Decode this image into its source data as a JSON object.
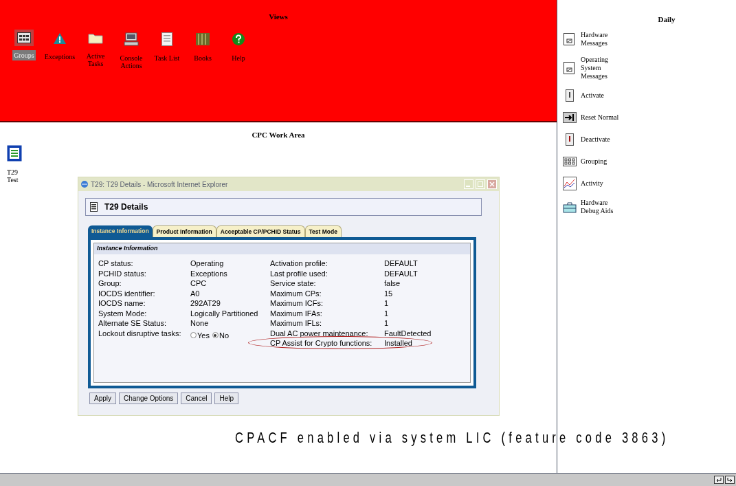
{
  "views": {
    "title": "Views",
    "items": [
      {
        "label": "Groups",
        "kind": "groups",
        "selected": true
      },
      {
        "label": "Exceptions",
        "kind": "warning",
        "selected": false
      },
      {
        "label": "Active Tasks",
        "kind": "folder",
        "selected": false
      },
      {
        "label": "Console Actions",
        "kind": "computer",
        "selected": false
      },
      {
        "label": "Task List",
        "kind": "list",
        "selected": false
      },
      {
        "label": "Books",
        "kind": "books",
        "selected": false
      },
      {
        "label": "Help",
        "kind": "help",
        "selected": false
      }
    ]
  },
  "work_area": {
    "title": "CPC Work Area",
    "objects": [
      {
        "label": "T29 Test"
      }
    ]
  },
  "daily": {
    "title": "Daily",
    "items": [
      {
        "label": "Hardware Messages",
        "kind": "document"
      },
      {
        "label": "Operating System Messages",
        "kind": "document"
      },
      {
        "label": "Activate",
        "kind": "activate"
      },
      {
        "label": "Reset Normal",
        "kind": "reset"
      },
      {
        "label": "Deactivate",
        "kind": "deactivate"
      },
      {
        "label": "Grouping",
        "kind": "groups"
      },
      {
        "label": "Activity",
        "kind": "activity"
      },
      {
        "label": "Hardware Debug Aids",
        "kind": "toolbox"
      }
    ]
  },
  "dialog": {
    "window_title": "T29: T29 Details - Microsoft Internet Explorer",
    "header": "T29 Details",
    "tabs": [
      {
        "label": "Instance Information",
        "selected": true
      },
      {
        "label": "Product Information",
        "selected": false
      },
      {
        "label": "Acceptable CP/PCHID Status",
        "selected": false
      },
      {
        "label": "Test Mode",
        "selected": false
      }
    ],
    "section_title": "Instance Information",
    "left_fields": [
      {
        "label": "CP status:",
        "kind": "text",
        "value": "Operating"
      },
      {
        "label": "PCHID status:",
        "kind": "text",
        "value": "Exceptions"
      },
      {
        "label": "Group:",
        "kind": "text",
        "value": "CPC"
      },
      {
        "label": "IOCDS identifier:",
        "kind": "text",
        "value": "A0"
      },
      {
        "label": "IOCDS name:",
        "kind": "text",
        "value": "292AT29"
      },
      {
        "label": "System Mode:",
        "kind": "text",
        "value": "Logically Partitioned"
      },
      {
        "label": "Alternate SE Status:",
        "kind": "text",
        "value": "None"
      },
      {
        "label": "Lockout disruptive tasks:",
        "kind": "radio",
        "options": [
          {
            "label": "Yes",
            "selected": false
          },
          {
            "label": "No",
            "selected": true
          }
        ]
      }
    ],
    "right_fields": [
      {
        "label": "Activation profile:",
        "value": "DEFAULT",
        "circled": false
      },
      {
        "label": "Last profile used:",
        "value": "DEFAULT",
        "circled": false
      },
      {
        "label": "Service state:",
        "value": "false",
        "circled": false
      },
      {
        "label": "Maximum CPs:",
        "value": "15",
        "circled": false
      },
      {
        "label": "Maximum ICFs:",
        "value": "1",
        "circled": false
      },
      {
        "label": "Maximum IFAs:",
        "value": "1",
        "circled": false
      },
      {
        "label": "Maximum IFLs:",
        "value": "1",
        "circled": false
      },
      {
        "label": "Dual AC power maintenance:",
        "value": "FaultDetected",
        "circled": false
      },
      {
        "label": "CP Assist for Crypto functions:",
        "value": "Installed",
        "circled": true
      }
    ],
    "buttons": [
      "Apply",
      "Change Options",
      "Cancel",
      "Help"
    ]
  },
  "annotation": "CPACF enabled via system LIC (feature code 3863)"
}
